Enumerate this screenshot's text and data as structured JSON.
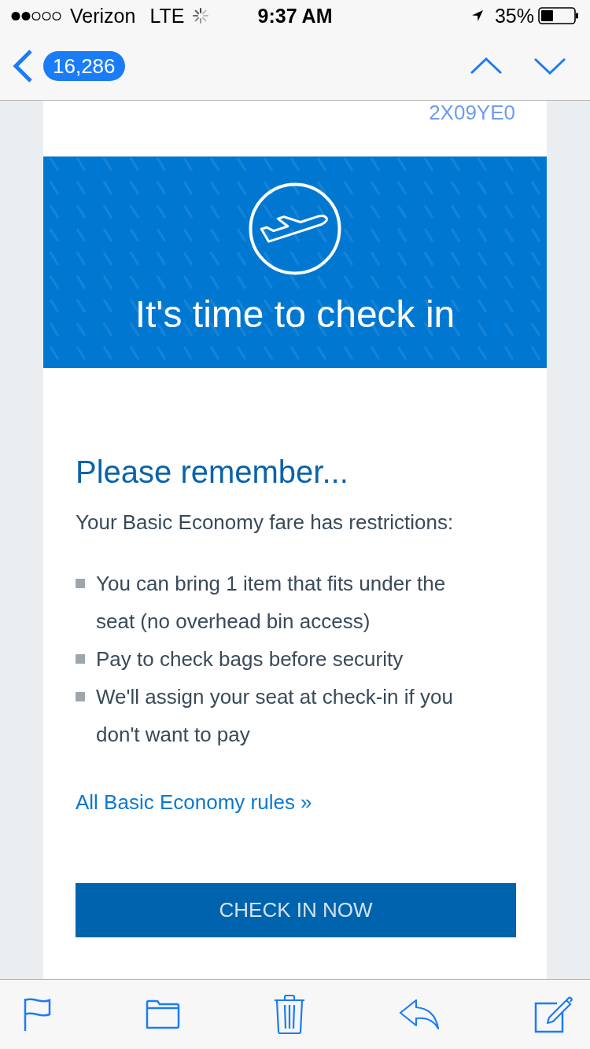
{
  "status_bar": {
    "carrier": "Verizon",
    "network": "LTE",
    "time": "9:37 AM",
    "battery": "35%"
  },
  "nav_bar": {
    "message_count": "16,286"
  },
  "email": {
    "reference": "2X09YE0",
    "banner_title": "It's time to check in",
    "heading": "Please remember...",
    "intro": "Your Basic Economy fare has restrictions:",
    "restrictions": [
      "You can bring 1 item that fits under the seat (no overhead bin access)",
      "Pay to check bags before security",
      "We'll assign your seat at check-in if you don't want to pay"
    ],
    "link": "All Basic Economy rules »",
    "button": "CHECK IN NOW"
  }
}
